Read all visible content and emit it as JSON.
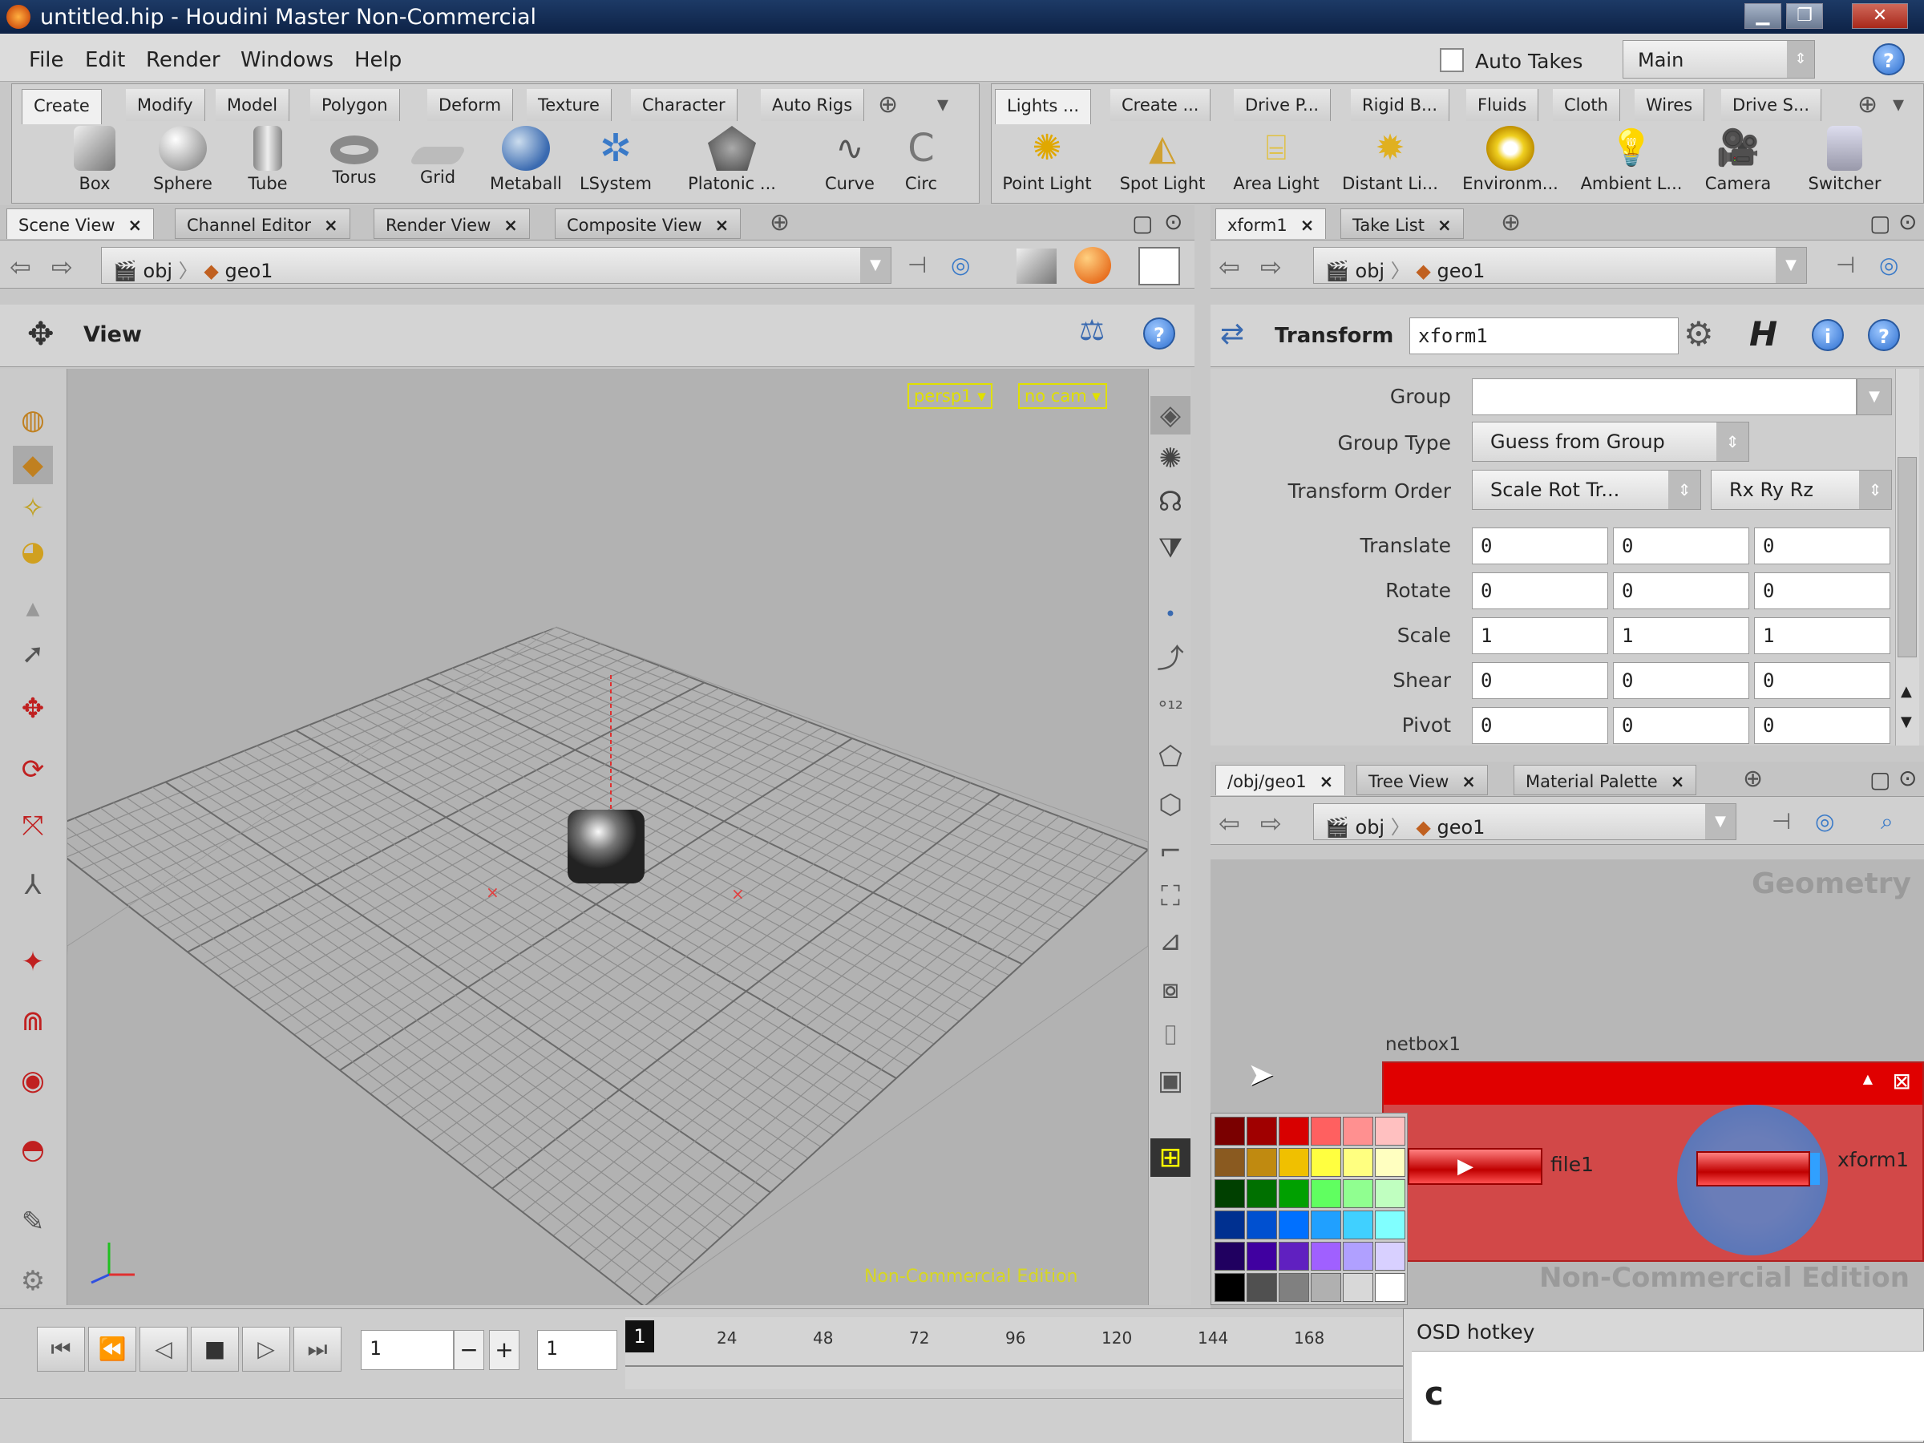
{
  "window": {
    "title": "untitled.hip - Houdini Master Non-Commercial",
    "min": "▁",
    "max": "❐",
    "close": "✕"
  },
  "menu": {
    "items": [
      "File",
      "Edit",
      "Render",
      "Windows",
      "Help"
    ],
    "auto_takes": "Auto Takes",
    "desktop": "Main"
  },
  "shelf_left": {
    "tabs": [
      "Create",
      "Modify",
      "Model",
      "Polygon",
      "Deform",
      "Texture",
      "Character",
      "Auto Rigs"
    ],
    "tools": [
      "Box",
      "Sphere",
      "Tube",
      "Torus",
      "Grid",
      "Metaball",
      "LSystem",
      "Platonic ...",
      "Curve",
      "Circ"
    ]
  },
  "shelf_right": {
    "tabs": [
      "Lights ...",
      "Create ...",
      "Drive P...",
      "Rigid B...",
      "Fluids",
      "Cloth",
      "Wires",
      "Drive S..."
    ],
    "tools": [
      "Point Light",
      "Spot Light",
      "Area Light",
      "Distant Li...",
      "Environm...",
      "Ambient L...",
      "Camera",
      "Switcher"
    ]
  },
  "scene_pane": {
    "tabs": [
      "Scene View",
      "Channel Editor",
      "Render View",
      "Composite View"
    ],
    "path": [
      "obj",
      "geo1"
    ],
    "view_label": "View",
    "camera_menu": [
      "persp1 ▾",
      "no cam ▾"
    ],
    "watermark": "Non-Commercial Edition"
  },
  "param_pane": {
    "tabs": [
      "xform1",
      "Take List"
    ],
    "path": [
      "obj",
      "geo1"
    ],
    "node_type": "Transform",
    "node_name": "xform1",
    "group_label": "Group",
    "group_value": "",
    "group_type_label": "Group Type",
    "group_type_value": "Guess from Group",
    "transform_order_label": "Transform Order",
    "transform_order_value": "Scale Rot Tr...",
    "rot_order_value": "Rx Ry Rz",
    "rows": [
      {
        "label": "Translate",
        "values": [
          "0",
          "0",
          "0"
        ]
      },
      {
        "label": "Rotate",
        "values": [
          "0",
          "0",
          "0"
        ]
      },
      {
        "label": "Scale",
        "values": [
          "1",
          "1",
          "1"
        ]
      },
      {
        "label": "Shear",
        "values": [
          "0",
          "0",
          "0"
        ]
      },
      {
        "label": "Pivot",
        "values": [
          "0",
          "0",
          "0"
        ]
      }
    ]
  },
  "network_pane": {
    "tabs": [
      "/obj/geo1",
      "Tree View",
      "Material Palette"
    ],
    "path": [
      "obj",
      "geo1"
    ],
    "context_label": "Geometry",
    "netbox_label": "netbox1",
    "node_a": "file1",
    "node_b": "xform1",
    "watermark": "Non-Commercial Edition",
    "palette_colors": [
      [
        "#7a0000",
        "#a00000",
        "#d80000",
        "#ff6060",
        "#ff9090",
        "#ffc0c0"
      ],
      [
        "#8a5a20",
        "#c08a10",
        "#f0c000",
        "#ffff40",
        "#ffff80",
        "#ffffc0"
      ],
      [
        "#004000",
        "#007000",
        "#00a000",
        "#60ff60",
        "#90ff90",
        "#c0ffc0"
      ],
      [
        "#003090",
        "#0050d0",
        "#0070ff",
        "#20a0ff",
        "#40d0ff",
        "#80ffff"
      ],
      [
        "#200060",
        "#4000a0",
        "#6020c0",
        "#a060ff",
        "#b0a0ff",
        "#d8d0ff"
      ],
      [
        "#000000",
        "#505050",
        "#808080",
        "#b0b0b0",
        "#d8d8d8",
        "#ffffff"
      ]
    ]
  },
  "timeline": {
    "frame": "1",
    "start": "1",
    "current_marker": "1",
    "ticks": [
      "24",
      "48",
      "72",
      "96",
      "120",
      "144",
      "168"
    ]
  },
  "osd": {
    "title": "OSD hotkey",
    "key": "c"
  }
}
